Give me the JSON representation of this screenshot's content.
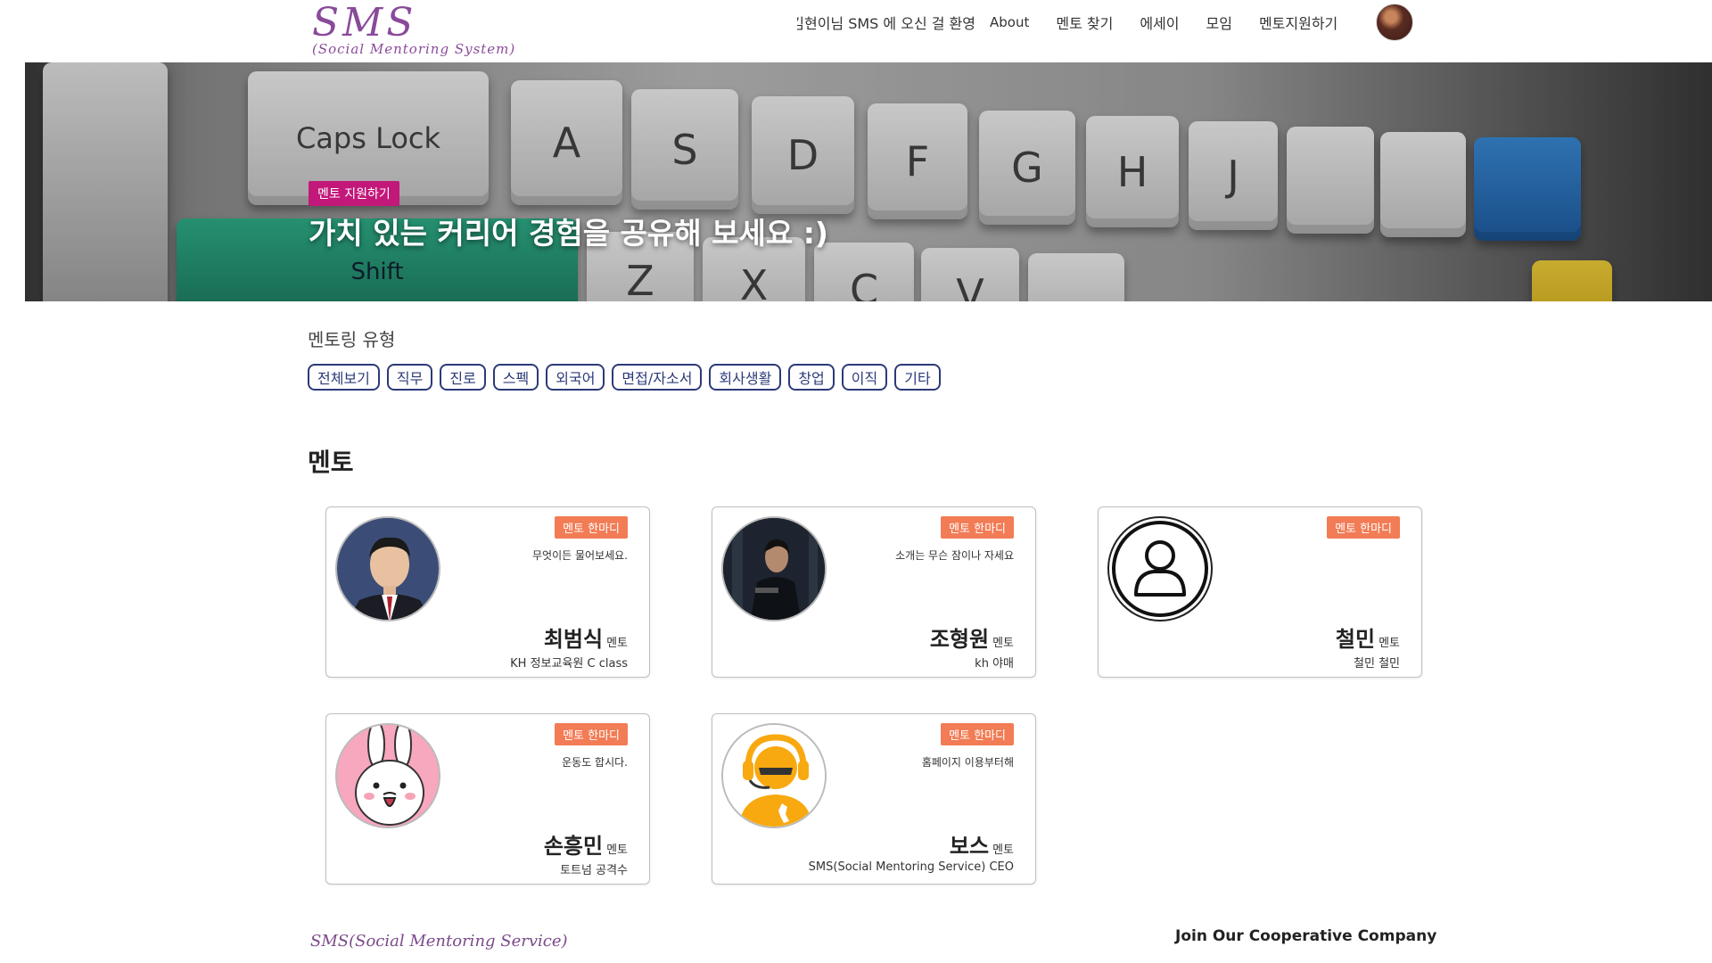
{
  "header": {
    "logo_main": "SMS",
    "logo_sub": "(Social Mentoring System)",
    "welcome": "김현이님 SMS 에 오신 걸 환영",
    "nav": [
      "About",
      "멘토 찾기",
      "에세이",
      "모임",
      "멘토지원하기"
    ]
  },
  "hero": {
    "badge": "멘토 지원하기",
    "title": "가치 있는 커리어 경험을 공유해 보세요 :)",
    "keys": [
      "Caps Lock",
      "A",
      "S",
      "D",
      "F",
      "G",
      "H",
      "J",
      "Shift",
      "Z",
      "X",
      "C",
      "V"
    ]
  },
  "types": {
    "label": "멘토링 유형",
    "chips": [
      "전체보기",
      "직무",
      "진로",
      "스펙",
      "외국어",
      "면접/자소서",
      "회사생활",
      "창업",
      "이직",
      "기타"
    ]
  },
  "section_title": "멘토",
  "mentors": [
    {
      "badge": "멘토 한마디",
      "quote": "무엇이든 물어보세요.",
      "name": "최범식",
      "role": "멘토",
      "org": "KH 정보교육원 C class",
      "photo": "suit-portrait"
    },
    {
      "badge": "멘토 한마디",
      "quote": "소개는 무슨 잠이나 자세요",
      "name": "조형원",
      "role": "멘토",
      "org": "kh 야매",
      "photo": "dark-portrait"
    },
    {
      "badge": "멘토 한마디",
      "quote": "",
      "name": "철민",
      "role": "멘토",
      "org": "철민 철민",
      "photo": "user-icon"
    },
    {
      "badge": "멘토 한마디",
      "quote": "운동도 합시다.",
      "name": "손흥민",
      "role": "멘토",
      "org": "토트넘 공격수",
      "photo": "bunny-character"
    },
    {
      "badge": "멘토 한마디",
      "quote": "홈페이지 이용부터해",
      "name": "보스",
      "role": "멘토",
      "org": "SMS(Social Mentoring Service) CEO",
      "photo": "support-agent-icon"
    }
  ],
  "footer": {
    "logo": "SMS(Social Mentoring Service)",
    "join": "Join Our Cooperative Company"
  },
  "colors": {
    "brand": "#8a4a9a",
    "hero_badge": "#c2187a",
    "chip_border": "#2c3a78",
    "card_badge": "#f27c55"
  }
}
